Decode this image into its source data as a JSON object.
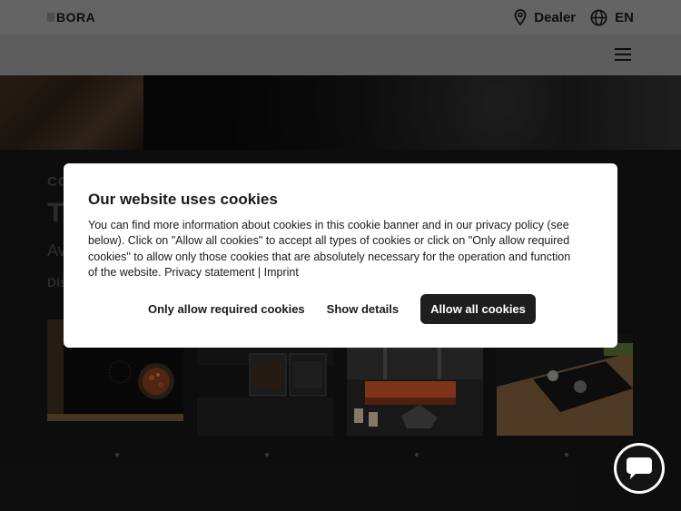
{
  "header": {
    "logo_text": "BORA",
    "dealer_label": "Dealer",
    "language_label": "EN",
    "icons": {
      "location": "location-pin-icon",
      "language": "globe-icon",
      "menu": "hamburger-menu-icon",
      "chat": "chat-icon"
    }
  },
  "background_text": {
    "line1": "CO",
    "line2": "T",
    "line3": "Av",
    "line4": "Dis"
  },
  "cookie_dialog": {
    "title": "Our website uses cookies",
    "body": "You can find more information about cookies in this cookie banner and in our privacy policy (see below). Click on \"Allow all cookies\" to accept all types of cookies or click on \"Only allow required cookies\" to allow only those cookies that are absolutely necessary for the operation and function of the website. Privacy statement | Imprint",
    "btn_required": "Only allow required cookies",
    "btn_details": "Show details",
    "btn_allow_all": "Allow all cookies"
  },
  "colors": {
    "primary_button": "#1e1e1e",
    "dialog_background": "#ffffff",
    "page_background": "#151515"
  }
}
